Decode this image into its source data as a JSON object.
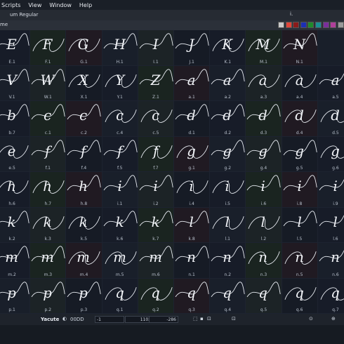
{
  "menu": {
    "items": [
      "Scripts",
      "View",
      "Window",
      "Help"
    ]
  },
  "title_bar": {
    "text": "um Regular",
    "glyph": "i."
  },
  "tab": {
    "label": "me"
  },
  "swatches": [
    "#c8c8c8",
    "#e0463a",
    "#8a1b1b",
    "#1c2fb5",
    "#1f8a2b",
    "#1b8f93",
    "#7a2f9c",
    "#b03f9a",
    "#9a9a9a",
    "#2a2f38"
  ],
  "glyph_rows": [
    {
      "letters": [
        "E",
        "F",
        "G",
        "H",
        "I",
        "J",
        "K",
        "M",
        "N",
        ""
      ],
      "labels": [
        "E.1",
        "F.1",
        "G.1",
        "H.1",
        "I.1",
        "J.1",
        "K.1",
        "M.1",
        "N.1",
        ""
      ]
    },
    {
      "letters": [
        "V",
        "W",
        "X",
        "Y",
        "Z",
        "a",
        "a",
        "a",
        "a",
        "a"
      ],
      "labels": [
        "V.1",
        "W.1",
        "X.1",
        "Y.1",
        "Z.1",
        "a.1",
        "a.2",
        "a.3",
        "a.4",
        "a.5"
      ]
    },
    {
      "letters": [
        "b",
        "c",
        "c",
        "c",
        "c",
        "d",
        "d",
        "d",
        "d",
        "d"
      ],
      "labels": [
        "b.7",
        "c.1",
        "c.2",
        "c.4",
        "c.5",
        "d.1",
        "d.2",
        "d.3",
        "d.4",
        "d.5"
      ]
    },
    {
      "letters": [
        "e",
        "f",
        "f",
        "f",
        "f",
        "g",
        "g",
        "g",
        "g",
        "g"
      ],
      "labels": [
        "e.5",
        "f.1",
        "f.4",
        "f.5",
        "f.7",
        "g.1",
        "g.2",
        "g.4",
        "g.5",
        "g.6"
      ]
    },
    {
      "letters": [
        "h",
        "h",
        "h",
        "i",
        "i",
        "i",
        "i",
        "i",
        "i",
        "i"
      ],
      "labels": [
        "h.6",
        "h.7",
        "h.8",
        "i.1",
        "i.2",
        "i.4",
        "i.5",
        "i.6",
        "i.8",
        "i.9"
      ]
    },
    {
      "letters": [
        "k",
        "k",
        "k",
        "k",
        "k",
        "l",
        "l",
        "l",
        "l",
        "l"
      ],
      "labels": [
        "k.2",
        "k.3",
        "k.5",
        "k.6",
        "k.7",
        "k.8",
        "l.1",
        "l.2",
        "l.5",
        "l.6"
      ]
    },
    {
      "letters": [
        "m",
        "m",
        "m",
        "m",
        "m",
        "n",
        "n",
        "n",
        "n",
        "n"
      ],
      "labels": [
        "m.2",
        "m.3",
        "m.4",
        "m.5",
        "m.6",
        "n.1",
        "n.2",
        "n.3",
        "n.5",
        "n.6"
      ]
    },
    {
      "letters": [
        "p",
        "p",
        "p",
        "q",
        "q",
        "q",
        "q",
        "q",
        "q",
        "q"
      ],
      "labels": [
        "p.1",
        "p.2",
        "p.3",
        "q.1",
        "q.2",
        "q.3",
        "q.4",
        "q.5",
        "q.6",
        "q.7"
      ]
    }
  ],
  "status": {
    "glyph_name": "Yacute",
    "unicode": "00DD",
    "x": "-1",
    "width": "1103",
    "y": "-286"
  }
}
